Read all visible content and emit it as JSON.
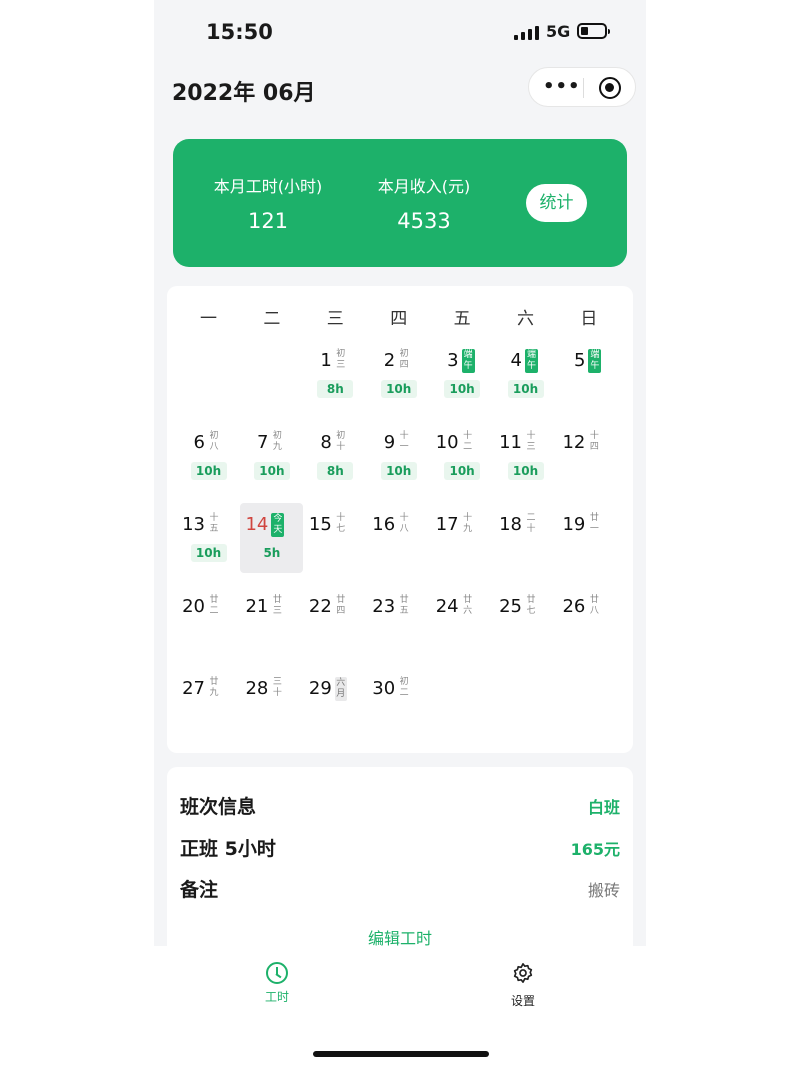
{
  "status_bar": {
    "time": "15:50",
    "network": "5G"
  },
  "header": {
    "month": "2022年 06月",
    "more_icon": "more-dots-icon",
    "close_icon": "target-circle-icon"
  },
  "summary": {
    "hours_label": "本月工时(小时)",
    "hours_value": "121",
    "income_label": "本月收入(元)",
    "income_value": "4533",
    "stats_button": "统计",
    "accent_color": "#1db16a"
  },
  "calendar": {
    "weekdays": [
      "一",
      "二",
      "三",
      "四",
      "五",
      "六",
      "日"
    ],
    "days": [
      {
        "d": "1",
        "l": "初三",
        "h": "8h"
      },
      {
        "d": "2",
        "l": "初四",
        "h": "10h"
      },
      {
        "d": "3",
        "l": "端午",
        "h": "10h",
        "holiday": true
      },
      {
        "d": "4",
        "l": "端午",
        "h": "10h",
        "holiday": true
      },
      {
        "d": "5",
        "l": "端午",
        "holiday": true
      },
      {
        "d": "6",
        "l": "初八",
        "h": "10h"
      },
      {
        "d": "7",
        "l": "初九",
        "h": "10h"
      },
      {
        "d": "8",
        "l": "初十",
        "h": "8h"
      },
      {
        "d": "9",
        "l": "十一",
        "h": "10h"
      },
      {
        "d": "10",
        "l": "十二",
        "h": "10h"
      },
      {
        "d": "11",
        "l": "十三",
        "h": "10h"
      },
      {
        "d": "12",
        "l": "十四"
      },
      {
        "d": "13",
        "l": "十五",
        "h": "10h"
      },
      {
        "d": "14",
        "l": "今天",
        "h": "5h",
        "today": true
      },
      {
        "d": "15",
        "l": "十七"
      },
      {
        "d": "16",
        "l": "十八"
      },
      {
        "d": "17",
        "l": "十九"
      },
      {
        "d": "18",
        "l": "二十"
      },
      {
        "d": "19",
        "l": "廿一"
      },
      {
        "d": "20",
        "l": "廿二"
      },
      {
        "d": "21",
        "l": "廿三"
      },
      {
        "d": "22",
        "l": "廿四"
      },
      {
        "d": "23",
        "l": "廿五"
      },
      {
        "d": "24",
        "l": "廿六"
      },
      {
        "d": "25",
        "l": "廿七"
      },
      {
        "d": "26",
        "l": "廿八"
      },
      {
        "d": "27",
        "l": "廿九"
      },
      {
        "d": "28",
        "l": "三十"
      },
      {
        "d": "29",
        "l": "六月",
        "month": true
      },
      {
        "d": "30",
        "l": "初二"
      }
    ]
  },
  "shift_info": {
    "title": "班次信息",
    "shift_type": "白班",
    "regular_label": "正班 5小时",
    "regular_amount": "165元",
    "note_label": "备注",
    "note_value": "搬砖",
    "edit_button": "编辑工时"
  },
  "tabbar": {
    "tabs": [
      {
        "label": "工时",
        "icon": "clock-icon",
        "active": true
      },
      {
        "label": "设置",
        "icon": "gear-icon",
        "active": false
      }
    ]
  }
}
